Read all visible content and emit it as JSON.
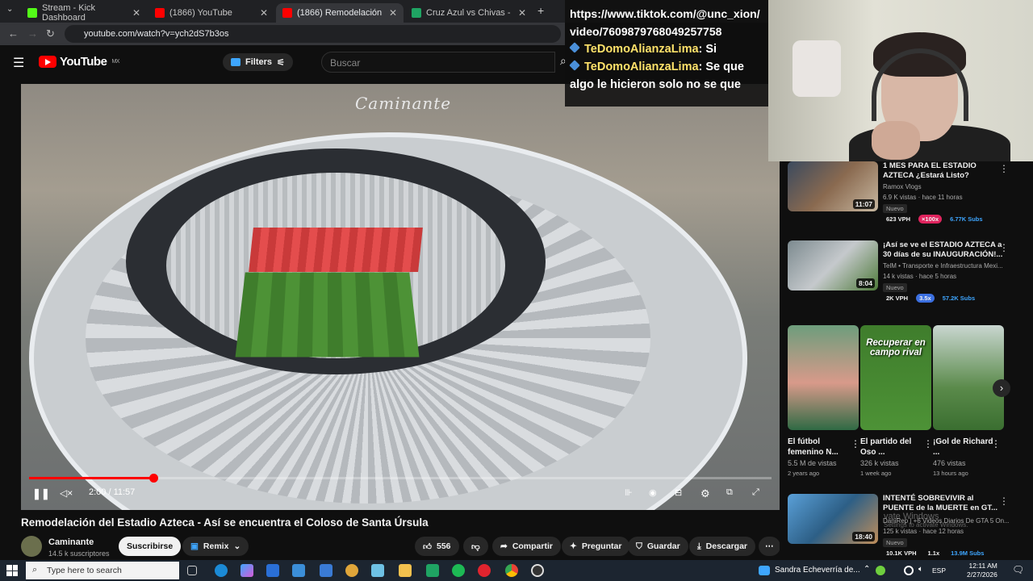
{
  "browser": {
    "tabs": [
      {
        "label": "Stream - Kick Dashboard",
        "color": "#53fc18"
      },
      {
        "label": "(1866) YouTube",
        "color": "#ff0000"
      },
      {
        "label": "(1866) Remodelación del Estad",
        "color": "#ff0000"
      },
      {
        "label": "Cruz Azul vs Chivas - marcador",
        "color": "#1fa463"
      }
    ],
    "url": "youtube.com/watch?v=ych2dS7b3os"
  },
  "youtube": {
    "logo": "YouTube",
    "country": "MX",
    "filters": "Filters",
    "search_placeholder": "Buscar"
  },
  "video": {
    "watermark": "Caminante",
    "time": "2:00 / 11:57",
    "progress": 0.167,
    "title": "Remodelación del Estadio Azteca - Así se encuentra el Coloso de Santa Úrsula",
    "channel": "Caminante",
    "subscribers": "14.5 k suscriptores",
    "subscribe": "Suscribirse",
    "remix": "Remix",
    "likes": "556",
    "share": "Compartir",
    "ask": "Preguntar",
    "save": "Guardar",
    "download": "Descargar"
  },
  "chat": {
    "line1": "https://www.tiktok.com/@unc_xion/video/7609879768049257758",
    "messages": [
      {
        "user": "TeDomoAlianzaLima",
        "text": ": Si"
      },
      {
        "user": "TeDomoAlianzaLima",
        "text": ": Se que algo le hicieron solo no se que"
      }
    ]
  },
  "recommendations": [
    {
      "title": "1 MES PARA EL ESTADIO AZTECA ¿Estará Listo?",
      "channel": "Ramox Vlogs",
      "meta": "6.9 K vistas · hace 11 horas",
      "duration": "11:07",
      "new": "Nuevo",
      "vph": "623 VPH",
      "mult": "×100x",
      "subs": "6.77K Subs"
    },
    {
      "title": "¡Así se ve el ESTADIO AZTECA a 30 días de su INAUGURACIÓN!...",
      "channel": "TelM • Transporte e Infraestructura Mexi...",
      "meta": "14 k vistas · hace 5 horas",
      "duration": "8:04",
      "new": "Nuevo",
      "vph": "2K VPH",
      "mult": "3.5x",
      "subs": "57.2K Subs"
    },
    {
      "title": "INTENTÉ SOBREVIVIR al PUENTE de la MUERTE en GT...",
      "channel": "DaniRep | +6 Videos Diarios De GTA 5 On...",
      "meta": "125 k vistas · hace 12 horas",
      "duration": "18:40",
      "new": "Nuevo",
      "vph": "10.1K VPH",
      "mult": "1.1x",
      "subs": "13.9M Subs"
    }
  ],
  "shorts": [
    {
      "title": "El fútbol femenino N...",
      "views": "5.5 M de vistas",
      "age": "2 years ago"
    },
    {
      "title": "El partido del Oso ...",
      "views": "326 k vistas",
      "age": "1 week ago",
      "overlay": "Recuperar en campo rival"
    },
    {
      "title": "¡Gol de Richard ...",
      "views": "476 vistas",
      "age": "13 hours ago"
    }
  ],
  "taskbar": {
    "search": "Type here to search",
    "weather": "Sandra Echeverría de...",
    "lang": "ESP",
    "time": "12:11 AM",
    "date": "2/27/2026"
  },
  "windows_activation": {
    "line1": "vate Windows",
    "line2": "Settings to activate Windows."
  }
}
